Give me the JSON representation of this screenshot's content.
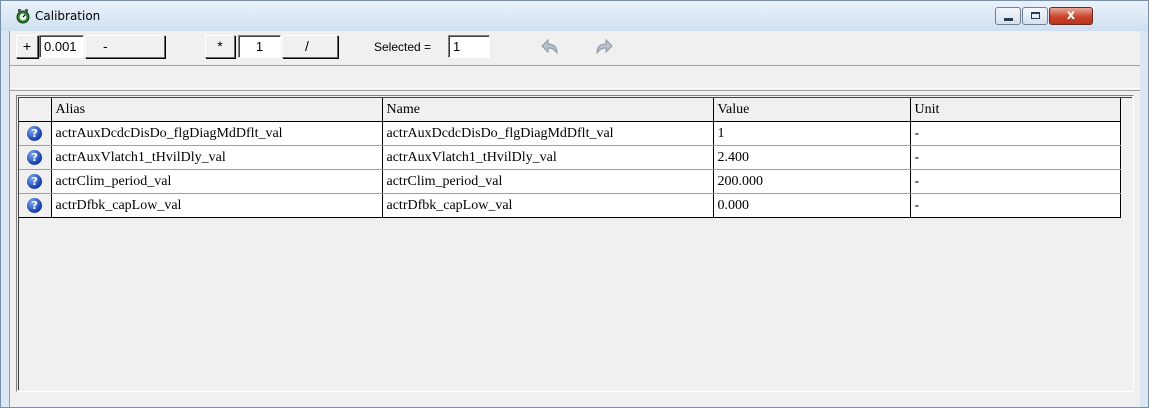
{
  "window": {
    "title": "Calibration",
    "controls": {
      "minimize_icon": "minimize-icon",
      "maximize_icon": "maximize-icon",
      "close_glyph": "x"
    }
  },
  "toolbar": {
    "plus_label": "+",
    "step_value": "0.001",
    "minus_label": "-",
    "multiply_label": "*",
    "factor_value": "1",
    "divide_label": "/",
    "selected_label": "Selected =",
    "selected_value": "1",
    "undo_icon": "undo-arrow-icon",
    "redo_icon": "redo-arrow-icon"
  },
  "status": {
    "text": ""
  },
  "table": {
    "columns": [
      "Alias",
      "Name",
      "Value",
      "Unit"
    ],
    "rows": [
      {
        "alias": "actrAuxDcdcDisDo_flgDiagMdDflt_val",
        "name": "actrAuxDcdcDisDo_flgDiagMdDflt_val",
        "value": "1",
        "unit": "-"
      },
      {
        "alias": "actrAuxVlatch1_tHvilDly_val",
        "name": "actrAuxVlatch1_tHvilDly_val",
        "value": "2.400",
        "unit": "-"
      },
      {
        "alias": "actrClim_period_val",
        "name": "actrClim_period_val",
        "value": "200.000",
        "unit": "-"
      },
      {
        "alias": "actrDfbk_capLow_val",
        "name": "actrDfbk_capLow_val",
        "value": "0.000",
        "unit": "-"
      }
    ],
    "row_icon": "help-icon"
  },
  "colors": {
    "titlebar": "#dde9f6",
    "close_button": "#c9432a",
    "help_icon": "#1d49b8",
    "face": "#f0f0f0"
  }
}
